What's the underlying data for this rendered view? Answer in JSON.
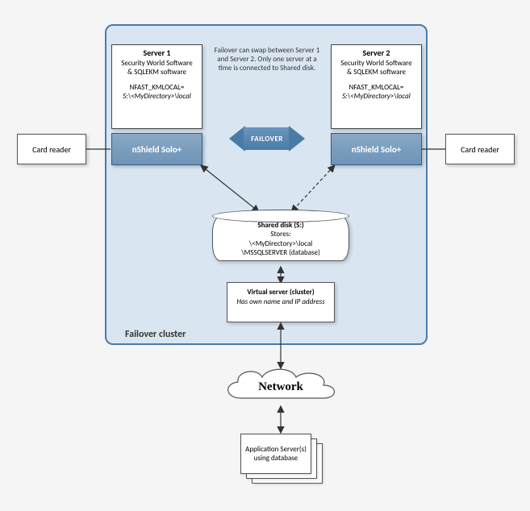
{
  "cluster": {
    "label": "Failover cluster"
  },
  "server1": {
    "title": "Server 1",
    "line1": "Security World Software",
    "line2": "& SQLEKM software",
    "env_label": "NFAST_KMLOCAL=",
    "env_path": "S:\\<MyDirectory>\\local"
  },
  "server2": {
    "title": "Server 2",
    "line1": "Security World Software",
    "line2": "& SQLEKM software",
    "env_label": "NFAST_KMLOCAL=",
    "env_path": "S:\\<MyDirectory>\\local"
  },
  "nshield": {
    "label": "nShield Solo+"
  },
  "card_reader": {
    "label": "Card reader"
  },
  "failover": {
    "note": "Failover can swap between Server 1 and Server 2. Only one server at a time is connected to Shared disk.",
    "badge": "FAILOVER"
  },
  "shared_disk": {
    "title": "Shared disk (S:)",
    "subtitle": "Stores:",
    "path1": "\\<MyDirectory>\\local",
    "path2": "\\MSSQLSERVER (database)"
  },
  "virtual_server": {
    "title": "Virtual server (cluster)",
    "subtitle": "Has own name and IP address"
  },
  "network": {
    "label": "Network"
  },
  "app_servers": {
    "label": "Application Server(s) using database"
  }
}
